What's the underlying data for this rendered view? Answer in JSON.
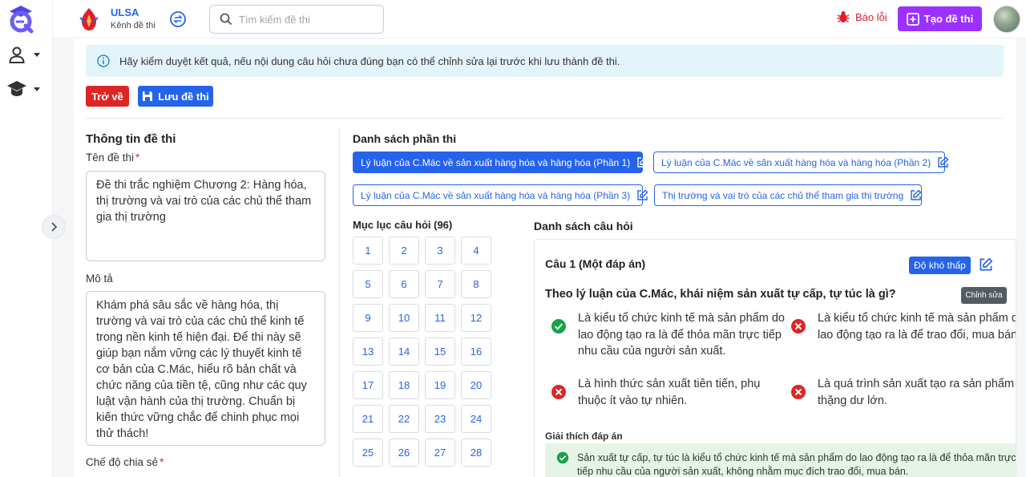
{
  "topbar": {
    "org_name": "ULSA",
    "org_sub": "Kênh đề thi",
    "search_placeholder": "Tìm kiếm đề thi",
    "report_label": "Báo lỗi",
    "create_label": "Tạo đề thi"
  },
  "alert": {
    "text": "Hãy kiểm duyệt kết quả, nếu nội dung câu hỏi chưa đúng bạn có thể chỉnh sửa lại trước khi lưu thành đề thi."
  },
  "actions": {
    "back_label": "Trở về",
    "save_label": "Lưu đề thi"
  },
  "info": {
    "section_title": "Thông tin đề thi",
    "name_label": "Tên đề thi",
    "name_value": "Đề thi trắc nghiệm Chương 2: Hàng hóa, thị trường và vai trò của các chủ thể tham gia thị trường",
    "desc_label": "Mô tả",
    "desc_value": "Khám phá sâu sắc về hàng hóa, thị trường và vai trò của các chủ thể kinh tế trong nền kinh tế hiện đại. Để thi này sẽ giúp bạn nắm vững các lý thuyết kinh tế cơ bản của C.Mác, hiểu rõ bản chất và chức năng của tiền tệ, cũng như các quy luật vận hành của thị trường. Chuẩn bị kiến thức vững chắc để chinh phục mọi thử thách!",
    "share_label": "Chế độ chia sẻ",
    "required_mark": "*"
  },
  "parts": {
    "section_title": "Danh sách phần thi",
    "items": [
      {
        "label": "Lý luận của C.Mác về sản xuất hàng hóa và hàng hóa (Phần 1)",
        "active": true
      },
      {
        "label": "Lý luận của C.Mác về sản xuất hàng hóa và hàng hóa (Phần 2)",
        "active": false
      },
      {
        "label": "Lý luận của C.Mác về sản xuất hàng hóa và hàng hóa (Phần 3)",
        "active": false
      },
      {
        "label": "Thị trường và vai trò của các chủ thể tham gia thị trường",
        "active": false
      }
    ]
  },
  "index": {
    "title": "Mục lục câu hỏi (96)",
    "numbers": [
      "1",
      "2",
      "3",
      "4",
      "5",
      "6",
      "7",
      "8",
      "9",
      "10",
      "11",
      "12",
      "13",
      "14",
      "15",
      "16",
      "17",
      "18",
      "19",
      "20",
      "21",
      "22",
      "23",
      "24",
      "25",
      "26",
      "27",
      "28"
    ]
  },
  "questions": {
    "section_title": "Danh sách câu hỏi",
    "q1": {
      "header": "Câu 1 (Một đáp án)",
      "difficulty": "Độ khó thấp",
      "edit_tooltip": "Chỉnh sửa",
      "text": "Theo lý luận của C.Mác, khái niệm sản xuất tự cấp, tự túc là gì?",
      "answers": [
        {
          "text": "Là kiểu tổ chức kinh tế mà sản phẩm do lao động tạo ra là để thỏa mãn trực tiếp nhu cầu của người sản xuất.",
          "correct": true
        },
        {
          "text": "Là kiểu tổ chức kinh tế mà sản phẩm do lao động tạo ra là để trao đổi, mua bán.",
          "correct": false
        },
        {
          "text": "Là hình thức sản xuất tiên tiến, phụ thuộc ít vào tự nhiên.",
          "correct": false
        },
        {
          "text": "Là quá trình sản xuất tạo ra sản phẩm thặng dư lớn.",
          "correct": false
        }
      ],
      "explain_title": "Giải thích đáp án",
      "explain_text": "Sản xuất tự cấp, tự túc là kiểu tổ chức kinh tế mà sản phẩm do lao động tạo ra là để thỏa mãn trực tiếp nhu cầu của người sản xuất, không nhằm mục đích trao đổi, mua bán."
    }
  },
  "colors": {
    "primary": "#2563eb",
    "danger": "#dc2626",
    "create": "#9b30ff",
    "success": "#16a34a",
    "alert_bg": "#e3f4fb"
  }
}
